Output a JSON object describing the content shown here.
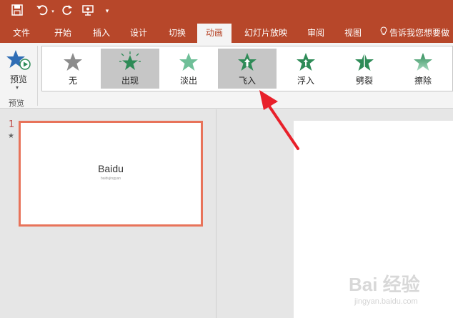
{
  "quick_access": {
    "save_icon": "save-icon",
    "undo_icon": "undo-icon",
    "redo_icon": "redo-icon",
    "present_icon": "present-from-start-icon",
    "customize_icon": "customize-qat-icon"
  },
  "tabs": [
    {
      "label": "文件"
    },
    {
      "label": "开始"
    },
    {
      "label": "插入"
    },
    {
      "label": "设计"
    },
    {
      "label": "切换"
    },
    {
      "label": "动画",
      "active": true
    },
    {
      "label": "幻灯片放映"
    },
    {
      "label": "审阅"
    },
    {
      "label": "视图"
    }
  ],
  "tell_me": "告诉我您想要做",
  "preview": {
    "label": "预览",
    "group_label": "预览"
  },
  "animations": [
    {
      "label": "无",
      "color": "#8c8c8c",
      "selected": false
    },
    {
      "label": "出现",
      "color": "#2e8b57",
      "selected": true
    },
    {
      "label": "淡出",
      "color": "#5fb08a",
      "selected": false
    },
    {
      "label": "飞入",
      "color": "#2e8b57",
      "selected": true
    },
    {
      "label": "浮入",
      "color": "#2e8b57",
      "selected": false
    },
    {
      "label": "劈裂",
      "color": "#2e8b57",
      "selected": false
    },
    {
      "label": "擦除",
      "color": "#5fb08a",
      "selected": false
    }
  ],
  "slides": [
    {
      "number": "1",
      "star": "★",
      "title": "Baidu",
      "subtitle": "baidujingyan"
    }
  ],
  "watermark": {
    "main": "Bai 经验",
    "sub": "jingyan.baidu.com"
  },
  "colors": {
    "accent": "#b7472a",
    "thumb_border": "#e8735a",
    "annotation": "#e8202a"
  }
}
